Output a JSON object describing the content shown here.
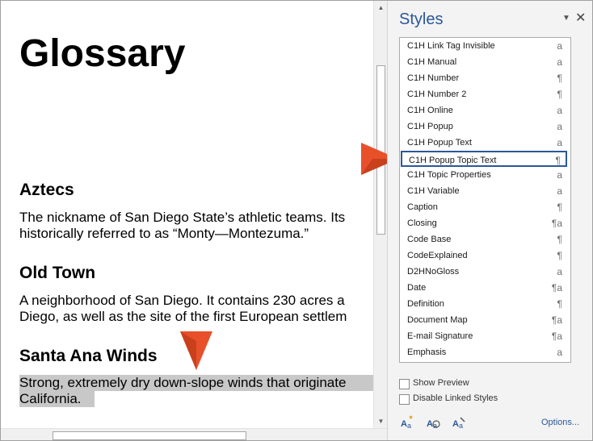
{
  "document": {
    "title": "Glossary",
    "entries": [
      {
        "term": "Aztecs",
        "lines": [
          "The nickname of San Diego State’s athletic teams. Its",
          "historically referred to as “Monty—Montezuma.”"
        ]
      },
      {
        "term": "Old Town",
        "lines": [
          "A neighborhood of San Diego. It contains 230 acres a",
          "Diego, as well as the site of the first European settlem"
        ]
      },
      {
        "term": "Santa Ana Winds",
        "lines": [
          "Strong, extremely dry down-slope winds that originate",
          "California. "
        ]
      }
    ]
  },
  "styles_pane": {
    "title": "Styles",
    "items": [
      {
        "name": "C1H Link Tag Invisible",
        "icon": "a"
      },
      {
        "name": "C1H Manual",
        "icon": "a"
      },
      {
        "name": "C1H Number",
        "icon": "¶"
      },
      {
        "name": "C1H Number 2",
        "icon": "¶"
      },
      {
        "name": "C1H Online",
        "icon": "a"
      },
      {
        "name": "C1H Popup",
        "icon": "a"
      },
      {
        "name": "C1H Popup Text",
        "icon": "a"
      },
      {
        "name": "C1H Popup Topic Text",
        "icon": "¶"
      },
      {
        "name": "C1H Topic Properties",
        "icon": "a"
      },
      {
        "name": "C1H Variable",
        "icon": "a"
      },
      {
        "name": "Caption",
        "icon": "¶"
      },
      {
        "name": "Closing",
        "icon": "¶a"
      },
      {
        "name": "Code Base",
        "icon": "¶"
      },
      {
        "name": "CodeExplained",
        "icon": "¶"
      },
      {
        "name": "D2HNoGloss",
        "icon": "a"
      },
      {
        "name": "Date",
        "icon": "¶a"
      },
      {
        "name": "Definition",
        "icon": "¶"
      },
      {
        "name": "Document Map",
        "icon": "¶a"
      },
      {
        "name": "E-mail Signature",
        "icon": "¶a"
      },
      {
        "name": "Emphasis",
        "icon": "a"
      }
    ],
    "selected_item": "C1H Popup Topic Text",
    "show_preview_label": "Show Preview",
    "disable_linked_label": "Disable Linked Styles",
    "options_label": "Options...",
    "buttons": [
      "new-style-icon",
      "style-inspector-icon",
      "manage-styles-icon"
    ]
  },
  "colors": {
    "accent": "#2b579a",
    "callout": "#e8502a",
    "selection": "#c8c8c8"
  }
}
